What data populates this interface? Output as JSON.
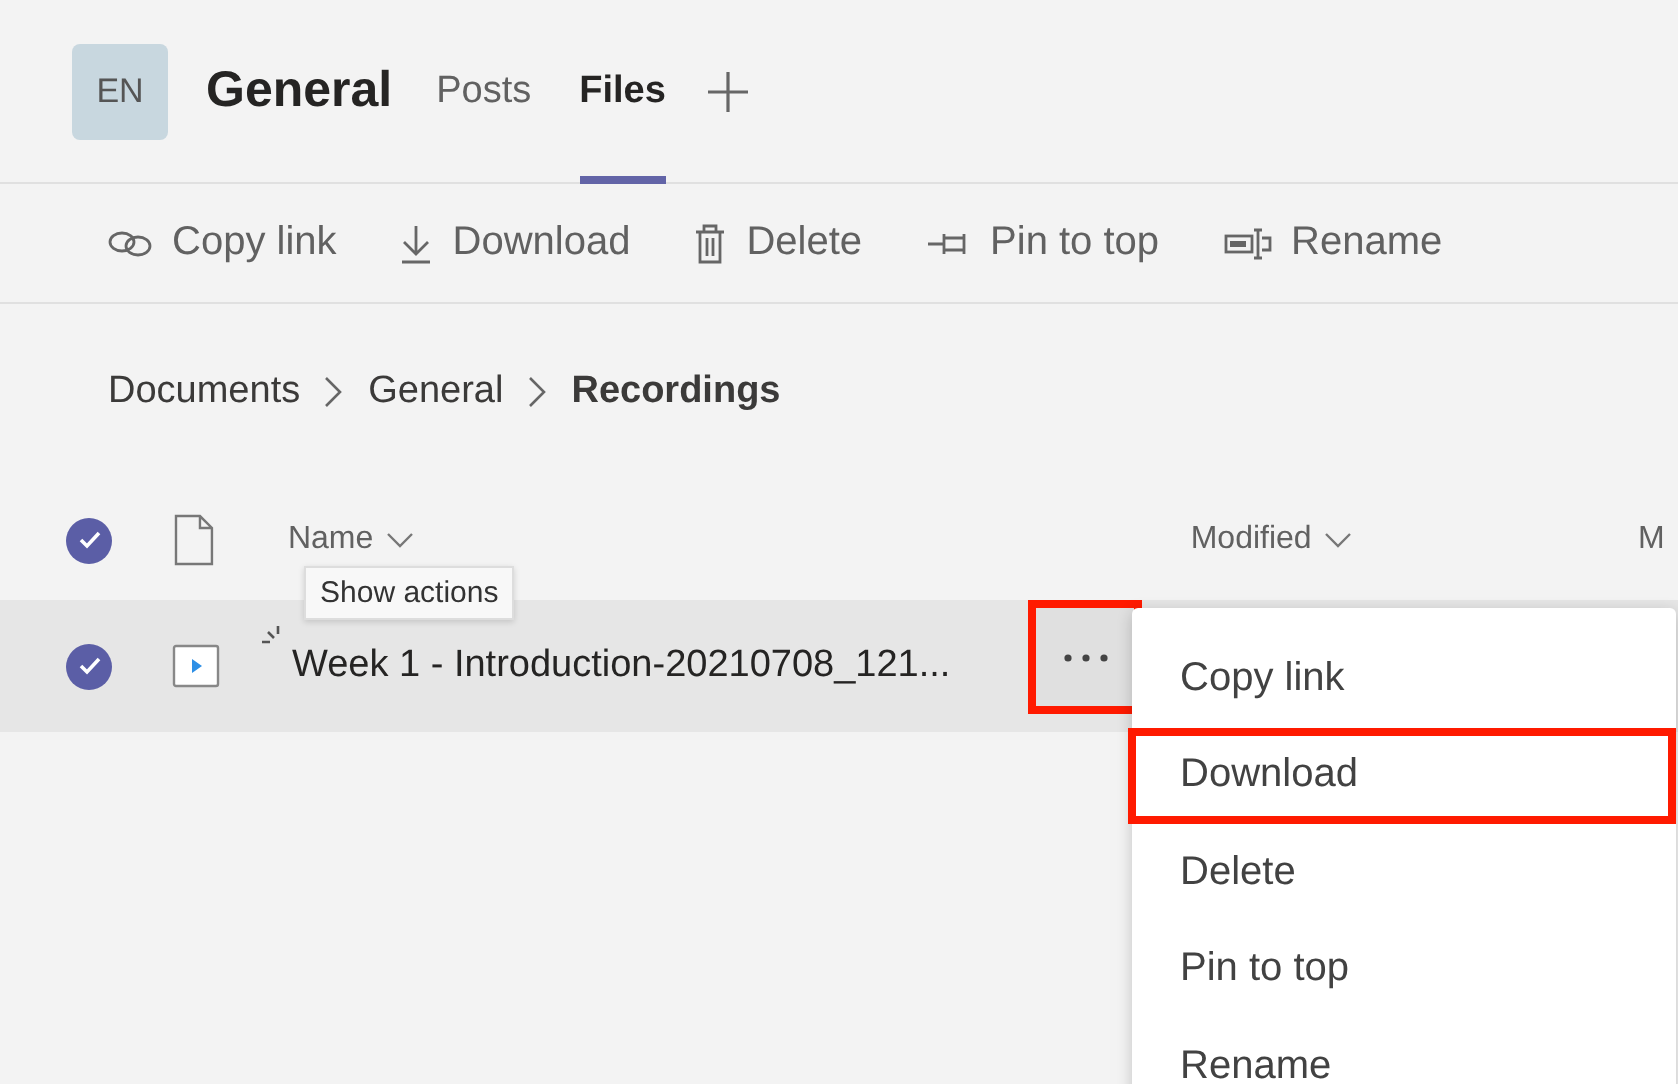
{
  "team": {
    "avatar": "EN",
    "name": "General"
  },
  "tabs": [
    {
      "label": "Posts",
      "selected": false
    },
    {
      "label": "Files",
      "selected": true
    }
  ],
  "toolbar": [
    {
      "kind": "link",
      "label": "Copy link"
    },
    {
      "kind": "download",
      "label": "Download"
    },
    {
      "kind": "delete",
      "label": "Delete"
    },
    {
      "kind": "pin",
      "label": "Pin to top"
    },
    {
      "kind": "rename",
      "label": "Rename"
    }
  ],
  "breadcrumb": [
    {
      "label": "Documents",
      "current": false
    },
    {
      "label": "General",
      "current": false
    },
    {
      "label": "Recordings",
      "current": true
    }
  ],
  "table": {
    "select_all_checked": true,
    "columns": [
      "Name",
      "Modified",
      "M"
    ],
    "rows": [
      {
        "name": "Week 1 - Introduction-20210708_121...",
        "kind": "video",
        "selected": true,
        "busy": true
      }
    ]
  },
  "tooltip": "Show actions",
  "more_button": {
    "highlighted": true
  },
  "menu": [
    {
      "label": "Copy link",
      "highlighted": false
    },
    {
      "label": "Download",
      "highlighted": true
    },
    {
      "label": "Delete",
      "highlighted": false
    },
    {
      "label": "Pin to top",
      "highlighted": false
    },
    {
      "label": "Rename",
      "highlighted": false
    }
  ]
}
